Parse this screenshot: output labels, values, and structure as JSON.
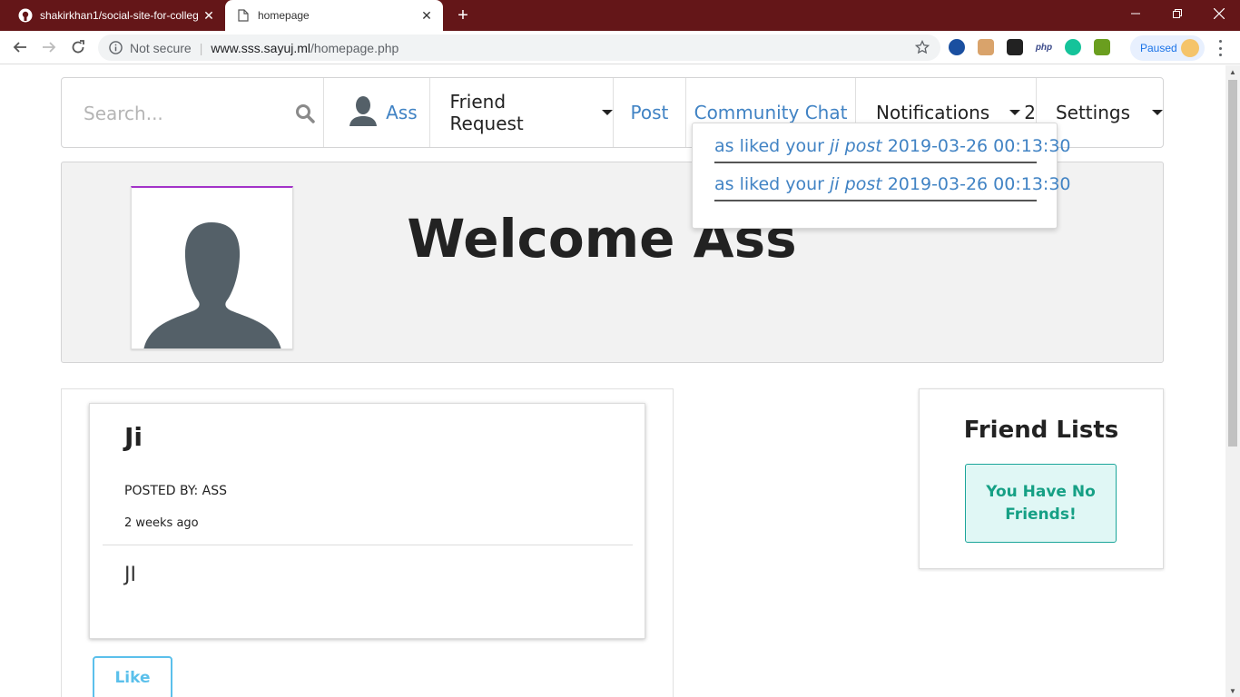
{
  "browser": {
    "tabs": [
      {
        "title": "shakirkhan1/social-site-for-colleg",
        "active": false
      },
      {
        "title": "homepage",
        "active": true
      }
    ],
    "security_label": "Not secure",
    "url_host": "www.sss.sayuj.ml",
    "url_path": "/homepage.php",
    "profile_status": "Paused",
    "extensions": [
      "php"
    ]
  },
  "menu": {
    "search_placeholder": "Search...",
    "profile_name": "Ass",
    "friend_request_label": "Friend Request",
    "post_label": "Post",
    "community_chat_label": "Community Chat",
    "notifications_label": "Notifications",
    "notifications_count": "2",
    "settings_label": "Settings"
  },
  "notifications": [
    {
      "prefix": "as liked your ",
      "post": "ji post",
      "timestamp": "2019-03-26 00:13:30"
    },
    {
      "prefix": "as liked your ",
      "post": "ji post",
      "timestamp": "2019-03-26 00:13:30"
    }
  ],
  "welcome": {
    "title": "Welcome Ass"
  },
  "post": {
    "title": "Ji",
    "posted_by": "POSTED BY: ASS",
    "time_ago": "2 weeks ago",
    "body": "JI",
    "like_label": "Like"
  },
  "friends": {
    "title": "Friend Lists",
    "empty_message": "You Have No Friends!"
  },
  "colors": {
    "tabbar": "#641618",
    "link": "#4183c4",
    "like": "#5bc0eb",
    "no_friends_bg": "#e0f7f5",
    "no_friends_text": "#16a085",
    "avatar_accent": "#a333c8"
  }
}
